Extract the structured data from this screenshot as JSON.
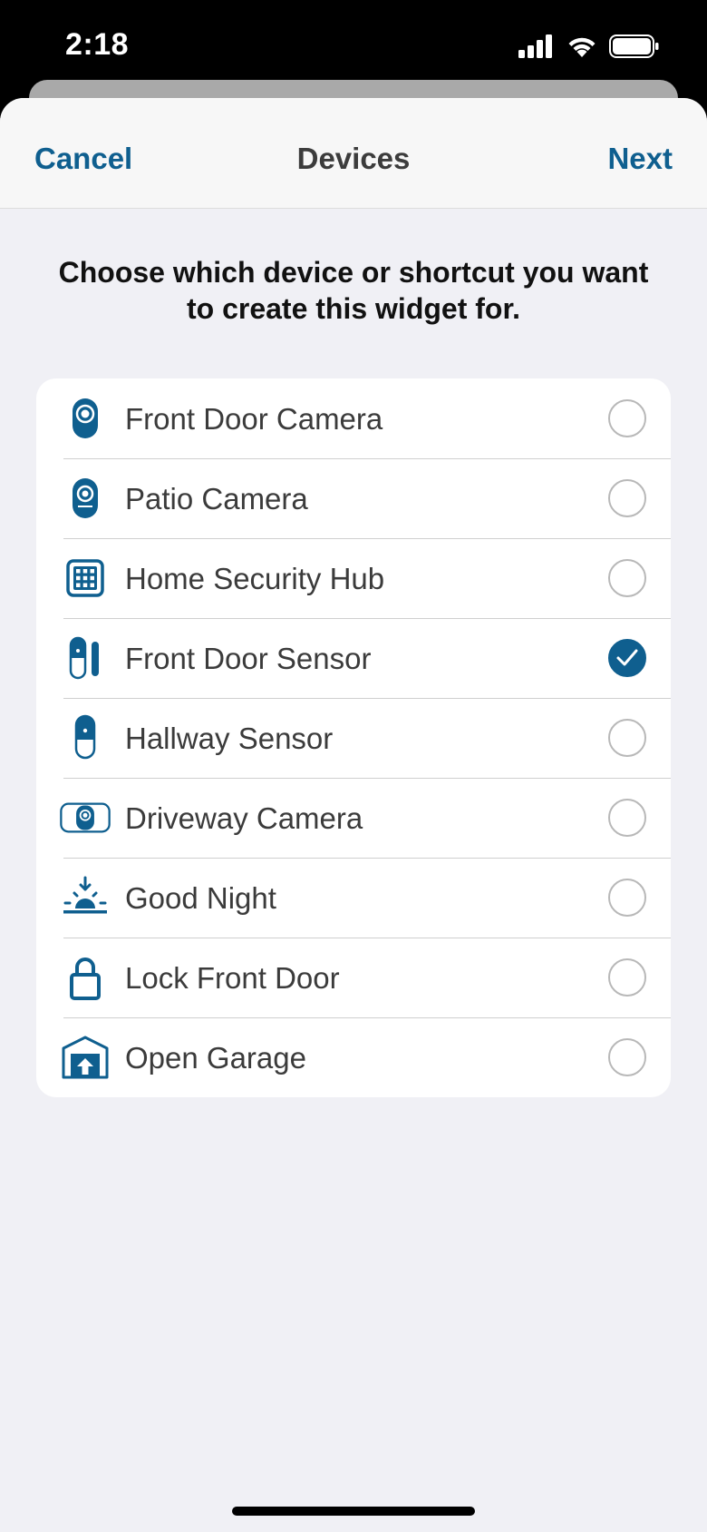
{
  "status_bar": {
    "time": "2:18"
  },
  "nav": {
    "cancel_label": "Cancel",
    "title": "Devices",
    "next_label": "Next"
  },
  "prompt": "Choose which device or shortcut you want to create this widget for.",
  "accent_color": "#0f5f8f",
  "devices": [
    {
      "label": "Front Door Camera",
      "icon": "camera-icon",
      "selected": false
    },
    {
      "label": "Patio Camera",
      "icon": "camera-icon",
      "selected": false
    },
    {
      "label": "Home Security Hub",
      "icon": "keypad-icon",
      "selected": false
    },
    {
      "label": "Front Door Sensor",
      "icon": "contact-sensor-icon",
      "selected": true
    },
    {
      "label": "Hallway Sensor",
      "icon": "motion-sensor-icon",
      "selected": false
    },
    {
      "label": "Driveway Camera",
      "icon": "floodlight-camera-icon",
      "selected": false
    },
    {
      "label": "Good Night",
      "icon": "sunset-icon",
      "selected": false
    },
    {
      "label": "Lock Front Door",
      "icon": "lock-icon",
      "selected": false
    },
    {
      "label": "Open Garage",
      "icon": "garage-icon",
      "selected": false
    }
  ]
}
